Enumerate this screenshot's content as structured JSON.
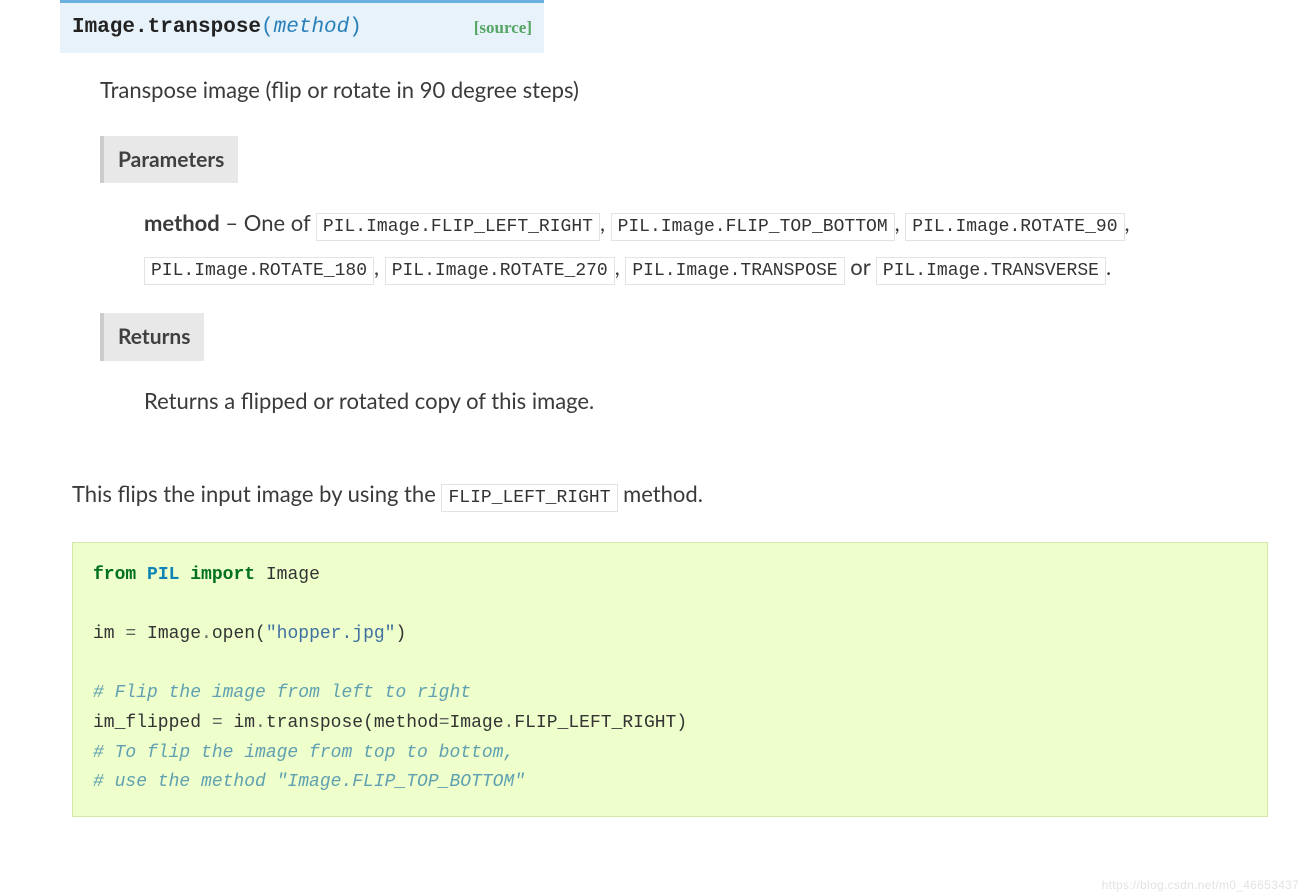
{
  "signature": {
    "qualname": "Image.transpose",
    "open_paren": "(",
    "param": "method",
    "close_paren": ")",
    "source_label": "[source]"
  },
  "description": "Transpose image (flip or rotate in 90 degree steps)",
  "fields": {
    "parameters_label": "Parameters",
    "param_name": "method",
    "param_lead": " – One of ",
    "constants": [
      "PIL.Image.FLIP_LEFT_RIGHT",
      "PIL.Image.FLIP_TOP_BOTTOM",
      "PIL.Image.ROTATE_90",
      "PIL.Image.ROTATE_180",
      "PIL.Image.ROTATE_270",
      "PIL.Image.TRANSPOSE",
      "PIL.Image.TRANSVERSE"
    ],
    "sep_comma": ",",
    "sep_or": " or ",
    "sep_period": ".",
    "returns_label": "Returns",
    "returns_text": "Returns a flipped or rotated copy of this image."
  },
  "intro": {
    "pre": "This flips the input image by using the ",
    "code": "FLIP_LEFT_RIGHT",
    "post": " method."
  },
  "code": {
    "l1_kw1": "from",
    "l1_mod": "PIL",
    "l1_kw2": "import",
    "l1_name": "Image",
    "l3_a": "im ",
    "l3_op": "=",
    "l3_b": " Image",
    "l3_dot": ".",
    "l3_c": "open(",
    "l3_str": "\"hopper.jpg\"",
    "l3_d": ")",
    "l5_c": "# Flip the image from left to right",
    "l6_a": "im_flipped ",
    "l6_op": "=",
    "l6_b": " im",
    "l6_dot": ".",
    "l6_c": "transpose(method",
    "l6_op2": "=",
    "l6_d": "Image",
    "l6_dot2": ".",
    "l6_e": "FLIP_LEFT_RIGHT)",
    "l7_c": "# To flip the image from top to bottom,",
    "l8_c": "# use the method \"Image.FLIP_TOP_BOTTOM\""
  },
  "watermark": "https://blog.csdn.net/m0_46653437"
}
